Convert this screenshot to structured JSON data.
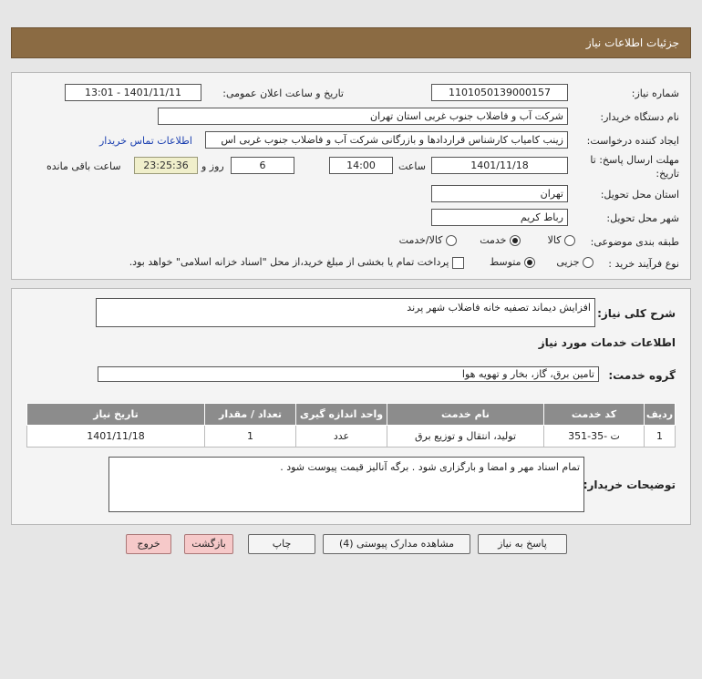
{
  "header": {
    "title": "جزئیات اطلاعات نیاز"
  },
  "form": {
    "need_number_label": "شماره نیاز:",
    "need_number": "1101050139000157",
    "announce_label": "تاریخ و ساعت اعلان عمومی:",
    "announce_value": "1401/11/11 - 13:01",
    "buyer_org_label": "نام دستگاه خریدار:",
    "buyer_org": "شرکت آب و فاضلاب جنوب غربی استان تهران",
    "requester_label": "ایجاد کننده درخواست:",
    "requester": "زینب کامیاب کارشناس قراردادها و بازرگانی شرکت آب و فاضلاب جنوب غربی اس",
    "contact_link": "اطلاعات تماس خریدار",
    "deadline_label_1": "مهلت ارسال پاسخ: تا",
    "deadline_label_2": "تاریخ:",
    "deadline_date": "1401/11/18",
    "time_label": "ساعت",
    "deadline_time": "14:00",
    "days_value": "6",
    "days_label": "روز و",
    "remaining_time": "23:25:36",
    "remaining_label": "ساعت باقی مانده",
    "province_label": "استان محل تحویل:",
    "province": "تهران",
    "city_label": "شهر محل تحویل:",
    "city": "رباط کریم",
    "category_label": "طبقه بندی موضوعی:",
    "category_options": [
      "کالا",
      "خدمت",
      "کالا/خدمت"
    ],
    "category_selected": "خدمت",
    "process_label": "نوع فرآیند خرید :",
    "process_options": [
      "جزیی",
      "متوسط"
    ],
    "process_selected": "متوسط",
    "payment_note": "پرداخت تمام یا بخشی از مبلغ خرید،از محل \"اسناد خزانه اسلامی\" خواهد بود."
  },
  "summary": {
    "general_label": "شرح کلی نیاز:",
    "general_value": "افزایش دیماند تصفیه خانه فاضلاب شهر پرند",
    "services_title": "اطلاعات خدمات مورد نیاز",
    "service_group_label": "گروه خدمت:",
    "service_group": "تامین برق، گاز، بخار و تهویه هوا",
    "table": {
      "headers": [
        "ردیف",
        "کد خدمت",
        "نام خدمت",
        "واحد اندازه گیری",
        "تعداد / مقدار",
        "تاریخ نیاز"
      ],
      "rows": [
        [
          "1",
          "ت -35-351",
          "تولید، انتقال و توزیع برق",
          "عدد",
          "1",
          "1401/11/18"
        ]
      ]
    },
    "buyer_notes_label": "توضیحات خریدار:",
    "buyer_notes": "تمام اسناد مهر و امضا و بارگزاری شود . برگه آنالیز قیمت پیوست شود ."
  },
  "buttons": {
    "reply": "پاسخ به نیاز",
    "attachments": "مشاهده مدارک پیوستی (4)",
    "print": "چاپ",
    "back": "بازگشت",
    "exit": "خروج"
  },
  "colors": {
    "header_bg": "#8b6b43",
    "table_header_bg": "#8c8c8c",
    "link": "#1a3fb0",
    "exit_button_bg": "#f6c9c9"
  }
}
